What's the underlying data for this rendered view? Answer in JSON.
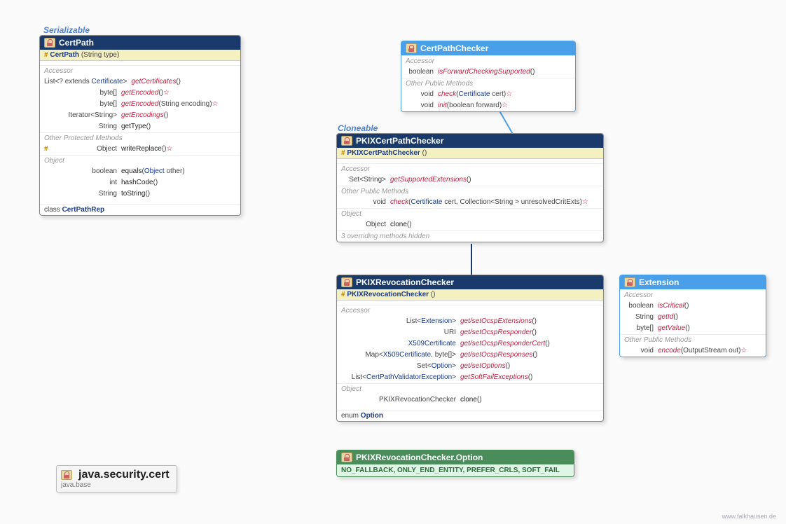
{
  "tags": {
    "serializable": "Serializable",
    "cloneable": "Cloneable"
  },
  "certpath": {
    "title": "CertPath",
    "ctor": {
      "hash": "#",
      "name": "CertPath",
      "param": "(String type)"
    },
    "sections": {
      "accessor": "Accessor",
      "otherProtected": "Other Protected Methods",
      "object": "Object"
    },
    "accessors": [
      {
        "ret_pre": "List<? extends ",
        "ret_link": "Certificate",
        "ret_post": ">",
        "name": "getCertificates",
        "params": "()"
      },
      {
        "ret": "byte[]",
        "name": "getEncoded",
        "params": "()",
        "throws": "☆"
      },
      {
        "ret": "byte[]",
        "name": "getEncoded",
        "params": "(String encoding)",
        "throws": "☆"
      },
      {
        "ret": "Iterator<String>",
        "name": "getEncodings",
        "params": "()"
      },
      {
        "ret": "String",
        "name": "getType",
        "params": "()"
      }
    ],
    "protected": [
      {
        "hash": "#",
        "ret": "Object",
        "name": "writeReplace",
        "params": "()",
        "throws": "☆"
      }
    ],
    "objectMethods": [
      {
        "ret": "boolean",
        "name": "equals",
        "params_pre": "(",
        "params_link": "Object",
        "params_post": " other)"
      },
      {
        "ret": "int",
        "name": "hashCode",
        "params": "()"
      },
      {
        "ret": "String",
        "name": "toString",
        "params": "()"
      }
    ],
    "inner": {
      "prefix": "class",
      "name": "CertPathRep"
    }
  },
  "certpathchecker": {
    "title": "CertPathChecker",
    "sections": {
      "accessor": "Accessor",
      "other": "Other Public Methods"
    },
    "accessors": [
      {
        "ret": "boolean",
        "name": "isForwardCheckingSupported",
        "params": "()"
      }
    ],
    "others": [
      {
        "ret": "void",
        "name": "check",
        "params_pre": "(",
        "params_link": "Certificate",
        "params_post": " cert)",
        "throws": "☆"
      },
      {
        "ret": "void",
        "name": "init",
        "params": "(boolean forward)",
        "throws": "☆"
      }
    ]
  },
  "pkixchecker": {
    "title": "PKIXCertPathChecker",
    "ctor": {
      "hash": "#",
      "name": "PKIXCertPathChecker",
      "param": "()"
    },
    "sections": {
      "accessor": "Accessor",
      "other": "Other Public Methods",
      "object": "Object"
    },
    "accessors": [
      {
        "ret": "Set<String>",
        "name": "getSupportedExtensions",
        "params": "()"
      }
    ],
    "others": [
      {
        "ret": "void",
        "name": "check",
        "params_pre": "(",
        "params_link": "Certificate",
        "params_mid": " cert, Collection<String > unresolvedCritExts)",
        "throws": "☆"
      }
    ],
    "objectMethods": [
      {
        "ret": "Object",
        "name": "clone",
        "params": "()"
      }
    ],
    "note": "3 overriding methods hidden"
  },
  "pkixrev": {
    "title": "PKIXRevocationChecker",
    "ctor": {
      "hash": "#",
      "name": "PKIXRevocationChecker",
      "param": "()"
    },
    "sections": {
      "accessor": "Accessor",
      "object": "Object"
    },
    "accessors": [
      {
        "ret_pre": "List<",
        "ret_link": "Extension",
        "ret_post": ">",
        "name": "get/setOcspExtensions",
        "params": "()"
      },
      {
        "ret": "URI",
        "name": "get/setOcspResponder",
        "params": "()"
      },
      {
        "ret_link": "X509Certificate",
        "name": "get/setOcspResponderCert",
        "params": "()"
      },
      {
        "ret_pre": "Map<",
        "ret_link": "X509Certificate",
        "ret_post": ", byte[]>",
        "name": "get/setOcspResponses",
        "params": "()"
      },
      {
        "ret_pre": "Set<",
        "ret_link": "Option",
        "ret_post": ">",
        "name": "get/setOptions",
        "params": "()"
      },
      {
        "ret_pre": "List<",
        "ret_link": "CertPathValidatorException",
        "ret_post": ">",
        "name": "getSoftFailExceptions",
        "params": "()"
      }
    ],
    "objectMethods": [
      {
        "ret": "PKIXRevocationChecker",
        "name": "clone",
        "params": "()"
      }
    ],
    "inner": {
      "prefix": "enum",
      "name": "Option"
    }
  },
  "extension": {
    "title": "Extension",
    "sections": {
      "accessor": "Accessor",
      "other": "Other Public Methods"
    },
    "accessors": [
      {
        "ret": "boolean",
        "name": "isCritical",
        "params": "()"
      },
      {
        "ret": "String",
        "name": "getId",
        "params": "()"
      },
      {
        "ret": "byte[]",
        "name": "getValue",
        "params": "()"
      }
    ],
    "others": [
      {
        "ret": "void",
        "name": "encode",
        "params": "(OutputStream out)",
        "throws": "☆"
      }
    ]
  },
  "option": {
    "title": "PKIXRevocationChecker.Option",
    "constants": "NO_FALLBACK, ONLY_END_ENTITY, PREFER_CRLS, SOFT_FAIL"
  },
  "pkg": {
    "title": "java.security.cert",
    "sub": "java.base"
  },
  "watermark": "www.falkhausen.de"
}
